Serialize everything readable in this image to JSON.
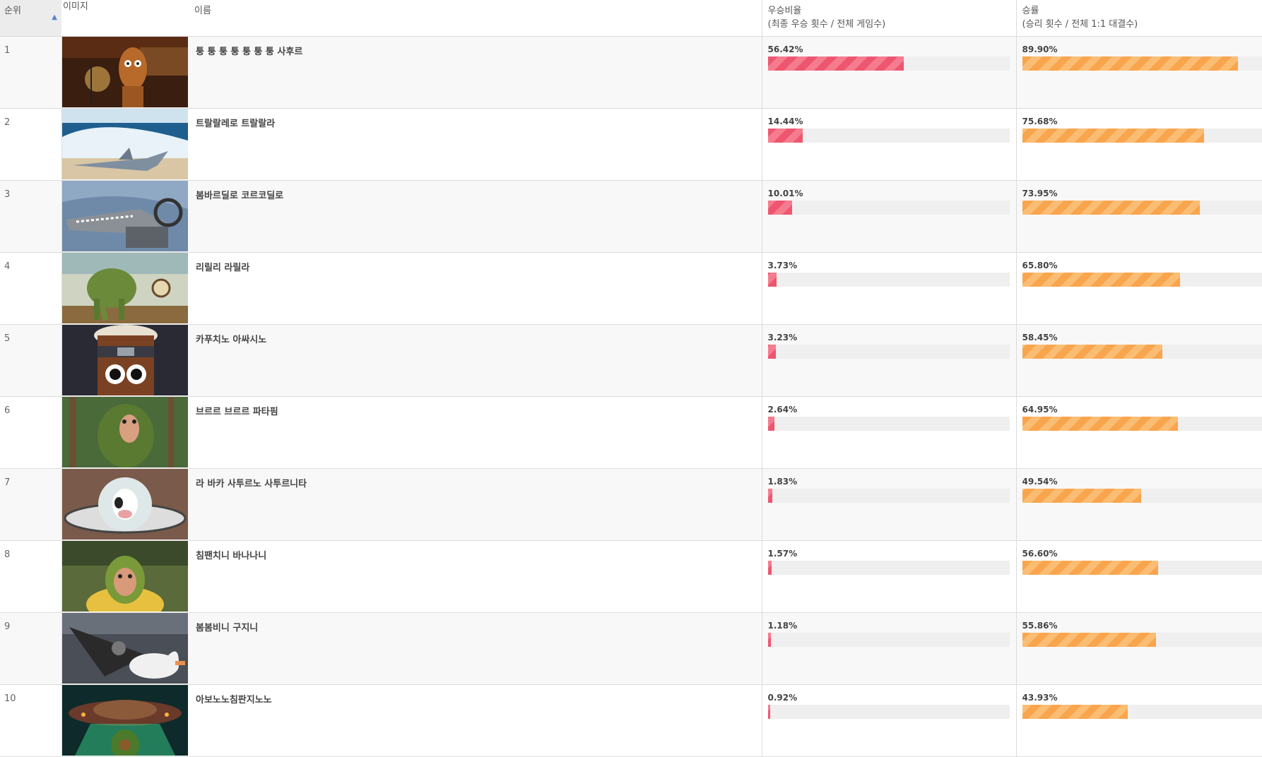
{
  "headers": {
    "rank": "순위",
    "image": "이미지",
    "name": "이름",
    "win_ratio_title": "우승비율",
    "win_ratio_sub": "(최종 우승 횟수 / 전체 게임수)",
    "win_rate_title": "승률",
    "win_rate_sub": "(승리 횟수 / 전체 1:1 대결수)"
  },
  "sort_icon": "sort-ascending-icon",
  "colors": {
    "win_bar": "#ee5670",
    "rate_bar": "#f8a54d"
  },
  "rows": [
    {
      "rank": "1",
      "name": "퉁 퉁 퉁 퉁 퉁 퉁 퉁 사후르",
      "win_ratio": "56.42%",
      "win_ratio_value": 56.42,
      "win_rate": "89.90%",
      "win_rate_value": 89.9,
      "image": "brown wooden figure in front of a signboard at night"
    },
    {
      "rank": "2",
      "name": "트랄랄레로 트랄랄라",
      "win_ratio": "14.44%",
      "win_ratio_value": 14.44,
      "win_rate": "75.68%",
      "win_rate_value": 75.68,
      "image": "shark wearing sneakers on a beach with waves"
    },
    {
      "rank": "3",
      "name": "봄바르딜로 코르코딜로",
      "win_ratio": "10.01%",
      "win_ratio_value": 10.01,
      "win_rate": "73.95%",
      "win_rate_value": 73.95,
      "image": "crocodile bomber airplane"
    },
    {
      "rank": "4",
      "name": "리릴리 라릴라",
      "win_ratio": "3.73%",
      "win_ratio_value": 3.73,
      "win_rate": "65.80%",
      "win_rate_value": 65.8,
      "image": "cactus elephant in the desert with a clock"
    },
    {
      "rank": "5",
      "name": "카푸치노 아싸시노",
      "win_ratio": "3.23%",
      "win_ratio_value": 3.23,
      "win_rate": "58.45%",
      "win_rate_value": 58.45,
      "image": "coffee cup ninja with headband"
    },
    {
      "rank": "6",
      "name": "브르르 브르르 파타핌",
      "win_ratio": "2.64%",
      "win_ratio_value": 2.64,
      "win_rate": "64.95%",
      "win_rate_value": 64.95,
      "image": "mossy monkey in a forest"
    },
    {
      "rank": "7",
      "name": "라 바카 사투르노 사투르니타",
      "win_ratio": "1.83%",
      "win_ratio_value": 1.83,
      "win_rate": "49.54%",
      "win_rate_value": 49.54,
      "image": "cow planet saturn"
    },
    {
      "rank": "8",
      "name": "침팬치니 바나나니",
      "win_ratio": "1.57%",
      "win_ratio_value": 1.57,
      "win_rate": "56.60%",
      "win_rate_value": 56.6,
      "image": "chimpanzee in a banana peel"
    },
    {
      "rank": "9",
      "name": "봄봄비니 구지니",
      "win_ratio": "1.18%",
      "win_ratio_value": 1.18,
      "win_rate": "55.86%",
      "win_rate_value": 55.86,
      "image": "goose with jet engines"
    },
    {
      "rank": "10",
      "name": "아보노노침판지노노",
      "win_ratio": "0.92%",
      "win_ratio_value": 0.92,
      "win_rate": "43.93%",
      "win_rate_value": 43.93,
      "image": "avocado ape under a UFO"
    }
  ]
}
